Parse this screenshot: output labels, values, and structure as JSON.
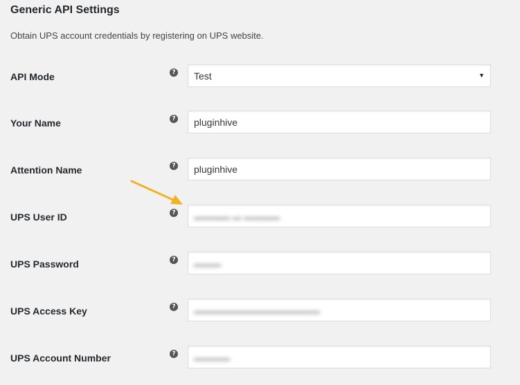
{
  "section": {
    "title": "Generic API Settings",
    "description": "Obtain UPS account credentials by registering on UPS website."
  },
  "colors": {
    "annotation_arrow": "#f0b323"
  },
  "fields": [
    {
      "label": "API Mode",
      "value": "Test",
      "type": "select",
      "icon": "help-icon"
    },
    {
      "label": "Your Name",
      "value": "pluginhive",
      "type": "text",
      "icon": "help-icon"
    },
    {
      "label": "Attention Name",
      "value": "pluginhive",
      "type": "text",
      "icon": "help-icon"
    },
    {
      "label": "UPS User ID",
      "type": "text",
      "obscured": true,
      "icon": "help-icon"
    },
    {
      "label": "UPS Password",
      "type": "password",
      "obscured": true,
      "icon": "help-icon"
    },
    {
      "label": "UPS Access Key",
      "type": "text",
      "obscured": true,
      "icon": "help-icon"
    },
    {
      "label": "UPS Account Number",
      "type": "text",
      "obscured": true,
      "icon": "help-icon"
    }
  ]
}
